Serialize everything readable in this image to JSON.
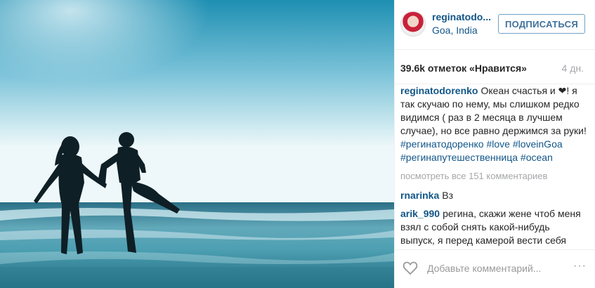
{
  "header": {
    "username": "reginatodo...",
    "location": "Goa, India",
    "follow_label": "ПОДПИСАТЬСЯ"
  },
  "stats": {
    "likes": "39.6k отметок «Нравится»",
    "time": "4 дн."
  },
  "caption": {
    "author": "reginatodorenko",
    "text_before_heart": "Океан счастья и",
    "heart": "❤",
    "text_after_heart": "! я так скучаю по нему, мы слишком редко видимся ( раз в 2 месяца в лучшем случае), но все равно держимся за руки!",
    "tags": [
      "#регинатодоренко",
      "#love",
      "#loveinGoa",
      "#регинапутешественница",
      "#ocean"
    ]
  },
  "view_all": "посмотреть все 151 комментариев",
  "comments": [
    {
      "author": "rnarinka",
      "text": "Вз"
    },
    {
      "author": "arik_990",
      "text": "регина, скажи жене чтоб меня взял с собой снять какой-нибудь выпуск, я перед камерой вести себя умею"
    }
  ],
  "footer": {
    "placeholder": "Добавьте комментарий...",
    "heart_icon": "heart-outline-icon",
    "more_icon": "more-dots-icon",
    "more_symbol": "···"
  }
}
